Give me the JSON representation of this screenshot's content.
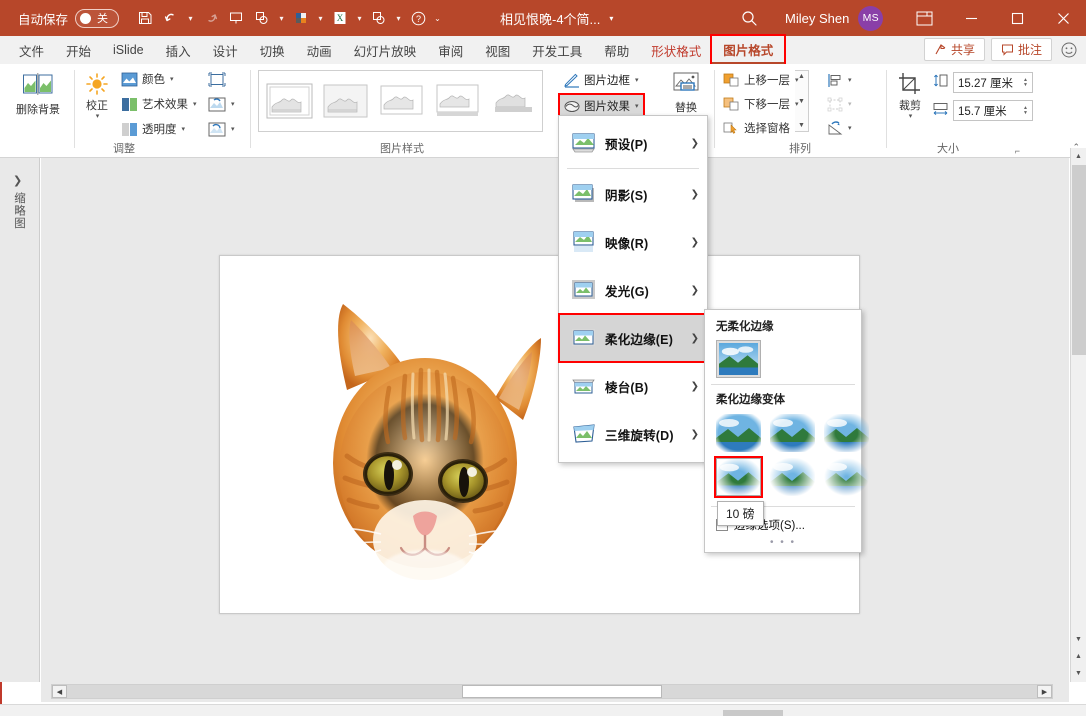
{
  "titlebar": {
    "autosave_label": "自动保存",
    "autosave_state": "关",
    "doc_title": "相见恨晚-4个简...",
    "user_name": "Miley Shen",
    "avatar_initials": "MS",
    "qat_icons": [
      "save-icon",
      "undo-icon",
      "redo-icon",
      "start-presentation-icon",
      "shapes-icon",
      "color-palette-icon",
      "excel-icon",
      "shape-merge-icon",
      "help-icon",
      "more-icon"
    ],
    "window_controls": [
      "minimize",
      "maximize",
      "close"
    ],
    "bg_color": "#b7472a",
    "avatar_color": "#8a3fa8"
  },
  "tabs": [
    {
      "label": "文件",
      "state": "normal"
    },
    {
      "label": "开始",
      "state": "normal"
    },
    {
      "label": "iSlide",
      "state": "normal"
    },
    {
      "label": "插入",
      "state": "normal"
    },
    {
      "label": "设计",
      "state": "normal"
    },
    {
      "label": "切换",
      "state": "normal"
    },
    {
      "label": "动画",
      "state": "normal"
    },
    {
      "label": "幻灯片放映",
      "state": "normal"
    },
    {
      "label": "审阅",
      "state": "normal"
    },
    {
      "label": "视图",
      "state": "normal"
    },
    {
      "label": "开发工具",
      "state": "normal"
    },
    {
      "label": "帮助",
      "state": "normal"
    },
    {
      "label": "形状格式",
      "state": "contextual"
    },
    {
      "label": "图片格式",
      "state": "active-highlighted"
    }
  ],
  "tabbar_right": {
    "share_label": "共享",
    "comments_label": "批注",
    "smiley_icon": "smiley-icon"
  },
  "ribbon": {
    "groups": [
      {
        "name": "调整",
        "label": "调整",
        "buttons": [
          {
            "label": "删除背景",
            "icon": "remove-background-icon",
            "type": "big"
          },
          {
            "label": "校正",
            "icon": "corrections-icon",
            "type": "big"
          },
          {
            "label": "颜色",
            "icon": "color-icon",
            "type": "small"
          },
          {
            "label": "艺术效果",
            "icon": "artistic-effects-icon",
            "type": "small"
          },
          {
            "label": "透明度",
            "icon": "transparency-icon",
            "type": "small"
          },
          {
            "label": "",
            "icon": "compress-pictures-icon",
            "type": "icon"
          },
          {
            "label": "",
            "icon": "change-picture-icon",
            "type": "icon"
          },
          {
            "label": "",
            "icon": "reset-picture-icon",
            "type": "icon"
          }
        ]
      },
      {
        "name": "图片样式",
        "label": "图片样式",
        "gallery_count": 5
      },
      {
        "name": "图片效果组",
        "buttons": [
          {
            "label": "图片边框",
            "icon": "picture-border-icon"
          },
          {
            "label": "图片效果",
            "icon": "picture-effects-icon",
            "highlighted": true
          },
          {
            "label": "替换",
            "icon": "picture-layout-icon"
          }
        ]
      },
      {
        "name": "排列",
        "label": "排列",
        "buttons": [
          {
            "label": "上移一层",
            "icon": "bring-forward-icon"
          },
          {
            "label": "下移一层",
            "icon": "send-backward-icon"
          },
          {
            "label": "选择窗格",
            "icon": "selection-pane-icon"
          },
          {
            "label": "",
            "icon": "align-icon"
          },
          {
            "label": "",
            "icon": "group-icon"
          },
          {
            "label": "",
            "icon": "rotate-icon"
          }
        ]
      },
      {
        "name": "大小",
        "label": "大小",
        "crop_label": "裁剪",
        "crop_icon": "crop-icon",
        "height_value": "15.27 厘米",
        "width_value": "15.7 厘米",
        "height_icon": "shape-height-icon",
        "width_icon": "shape-width-icon",
        "dialog_launcher": "dialog-launcher-icon"
      }
    ]
  },
  "menu": {
    "items": [
      {
        "label": "预设(P)",
        "icon": "preset-icon",
        "has_submenu": true,
        "selected": false
      },
      {
        "label": "阴影(S)",
        "icon": "shadow-icon",
        "has_submenu": true,
        "selected": false
      },
      {
        "label": "映像(R)",
        "icon": "reflection-icon",
        "has_submenu": true,
        "selected": false
      },
      {
        "label": "发光(G)",
        "icon": "glow-icon",
        "has_submenu": true,
        "selected": false
      },
      {
        "label": "柔化边缘(E)",
        "icon": "soft-edges-icon",
        "has_submenu": true,
        "selected": true
      },
      {
        "label": "棱台(B)",
        "icon": "bevel-icon",
        "has_submenu": true,
        "selected": false
      },
      {
        "label": "三维旋转(D)",
        "icon": "3d-rotation-icon",
        "has_submenu": true,
        "selected": false
      }
    ]
  },
  "submenu": {
    "none_heading": "无柔化边缘",
    "variants_heading": "柔化边缘变体",
    "variant_count": 6,
    "selected_variant_index": 3,
    "tooltip": "10 磅",
    "options_label": "边缘选项(S)...",
    "dots": "• • •"
  },
  "thumbnail_pane": {
    "expand_icon": "chevron-right-icon",
    "vertical_label": "缩略图"
  },
  "slide": {
    "image_name": "orange-cat-photo"
  },
  "scrollbars": {
    "vertical": {
      "up_icon": "▲",
      "down_icon": "▼",
      "prev_slide_icon": "▲",
      "next_slide_icon": "▼"
    },
    "horizontal": {
      "left_icon": "◀",
      "right_icon": "▶"
    }
  }
}
